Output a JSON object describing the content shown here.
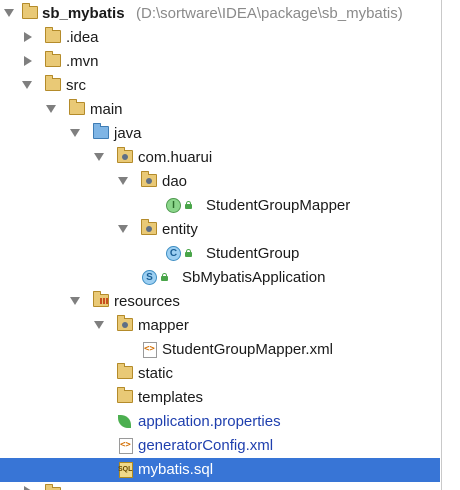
{
  "project": {
    "name": "sb_mybatis",
    "path": "(D:\\sortware\\IDEA\\package\\sb_mybatis)"
  },
  "tree": {
    "idea": ".idea",
    "mvn": ".mvn",
    "src": "src",
    "main": "main",
    "java": "java",
    "package": "com.huarui",
    "dao": "dao",
    "student_group_mapper": "StudentGroupMapper",
    "entity": "entity",
    "student_group": "StudentGroup",
    "application_class": "SbMybatisApplication",
    "resources": "resources",
    "mapper": "mapper",
    "mapper_xml": "StudentGroupMapper.xml",
    "static": "static",
    "templates": "templates",
    "app_properties": "application.properties",
    "generator_config": "generatorConfig.xml",
    "mybatis_sql": "mybatis.sql"
  },
  "icons": {
    "interface_badge": "I",
    "class_badge": "C",
    "spring_badge": "S"
  },
  "colors": {
    "selection": "#3875d6",
    "folder": "#e9c976",
    "source_folder": "#7fb5e5",
    "config_file_text": "#1f3fae"
  }
}
